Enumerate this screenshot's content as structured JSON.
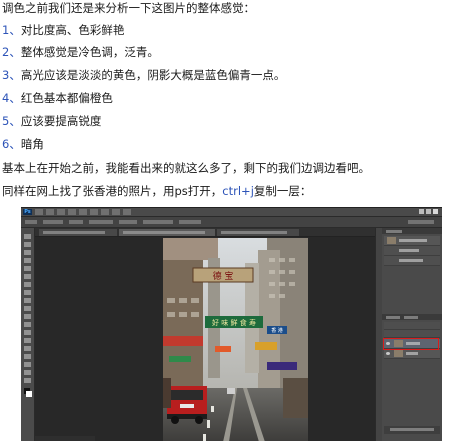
{
  "article": {
    "intro": "调色之前我们还是来分析一下这图片的整体感觉：",
    "points": [
      {
        "num": "1、",
        "text": "对比度高、色彩鲜艳"
      },
      {
        "num": "2、",
        "text": "整体感觉是冷色调，泛青。"
      },
      {
        "num": "3、",
        "text": "高光应该是淡淡的黄色，阴影大概是蓝色偏青一点。"
      },
      {
        "num": "4、",
        "text": "红色基本都偏橙色"
      },
      {
        "num": "5、",
        "text": "应该要提高锐度"
      },
      {
        "num": "6、",
        "text": "暗角"
      }
    ],
    "summary": "基本上在开始之前，我能看出来的就这么多了，剩下的我们边调边看吧。",
    "step_prefix": "同样在网上找了张香港的照片，用ps打开，",
    "step_shortcut": "ctrl+j",
    "step_suffix": "复制一层："
  },
  "screenshot": {
    "app_logo": "Ps",
    "photo_signs": {
      "top_sign": "德 宝",
      "green_sign": "好 味 鲜 食 寿",
      "blue_sign": "香 港"
    }
  },
  "colors": {
    "number_blue": "#2d54b8",
    "layer_highlight": "#d91c1c"
  }
}
